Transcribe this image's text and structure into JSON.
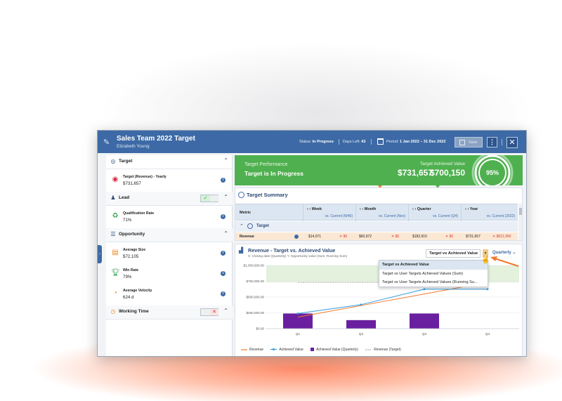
{
  "header": {
    "title": "Sales Team 2022 Target",
    "subtitle": "Elizabeth Young",
    "status_label": "Status:",
    "status_value": "In Progress",
    "days_left_label": "Days Left:",
    "days_left_value": "43",
    "period_label": "Period:",
    "period_value": "1 Jan 2022 – 31 Dec 2022",
    "save_label": "Save"
  },
  "sidebar": {
    "sections": [
      {
        "label": "Target",
        "items": [
          {
            "name": "Target (Revenue) - Yearly",
            "value": "$731,657"
          }
        ]
      },
      {
        "label": "Lead",
        "items": [
          {
            "name": "Qualification Rate",
            "value": "71%"
          }
        ]
      },
      {
        "label": "Opportunity",
        "items": [
          {
            "name": "Average Size",
            "value": "$72,105"
          },
          {
            "name": "Win Rate",
            "value": "79%"
          },
          {
            "name": "Average Velocity",
            "value": "624 d"
          }
        ]
      },
      {
        "label": "Working Time",
        "items": []
      }
    ]
  },
  "banner": {
    "perf_label": "Target Performance",
    "perf_status": "Target is In Progress",
    "target_label": "Target",
    "target_value": "$731,657",
    "achieved_label": "Achieved Value",
    "achieved_value": "$700,150",
    "percent": "95%",
    "percent_value": 0.95,
    "color": "#4fb04f"
  },
  "summary": {
    "title": "Target Summary",
    "metric_header": "Metric",
    "columns": [
      {
        "name": "Week",
        "sub": "vs. Current (W46)"
      },
      {
        "name": "Month",
        "sub": "vs. Current (Nov)"
      },
      {
        "name": "Quarter",
        "sub": "vs. Current (Q4)"
      },
      {
        "name": "Year",
        "sub": "vs. Current (2022)"
      }
    ],
    "group_label": "Target",
    "row": {
      "label": "Revenue",
      "values": [
        "$14,071",
        "$60,972",
        "$182,915",
        "$731,657"
      ],
      "deltas": [
        "$0",
        "$0",
        "$0",
        "$621,950"
      ]
    }
  },
  "chart_panel": {
    "title": "Revenue - Target vs. Achieved Value",
    "subtitle": "X: Closing date (Quarterly) Y: Opportunity value (Sum, Running Sum)",
    "view_select": "Target vs Achieved Value",
    "period_select": "Quarterly",
    "menu_options": [
      "Target vs Achieved Value",
      "Target vs User Targets Achieved Values (Sum)",
      "Target vs User Targets Achieved Values (Running Su..."
    ]
  },
  "chart_data": {
    "type": "bar",
    "categories": [
      "Q1",
      "Q2",
      "Q3",
      "Q4"
    ],
    "y_ticks": [
      "$1,000,000.00",
      "$750,000.00",
      "$500,000.00",
      "$250,000.00",
      "$0.00"
    ],
    "ylim": [
      0,
      1000000
    ],
    "series": [
      {
        "name": "Revenue",
        "type": "line",
        "color": "#f07a2e",
        "values": [
          183000,
          366000,
          549000,
          731657
        ]
      },
      {
        "name": "Achieved Value",
        "type": "line",
        "color": "#2e9be0",
        "values": [
          240000,
          380000,
          625000,
          625000
        ]
      },
      {
        "name": "Achieved Value (Quarterly)",
        "type": "bar",
        "color": "#6a1fa0",
        "values": [
          240000,
          135000,
          240000,
          0
        ]
      },
      {
        "name": "Revenue (Target)",
        "type": "dashed",
        "color": "#999999",
        "values": [
          731657,
          731657,
          731657,
          731657
        ]
      }
    ],
    "target_band": [
      731657,
      1000000
    ],
    "legend": [
      "Revenue",
      "Achieved Value",
      "Achieved Value (Quarterly)",
      "Revenue (Target)"
    ],
    "legend_position": "bottom"
  },
  "colors": {
    "header_blue": "#3d6aa6",
    "accent_green": "#4fb04f",
    "accent_orange": "#f07a2e"
  }
}
